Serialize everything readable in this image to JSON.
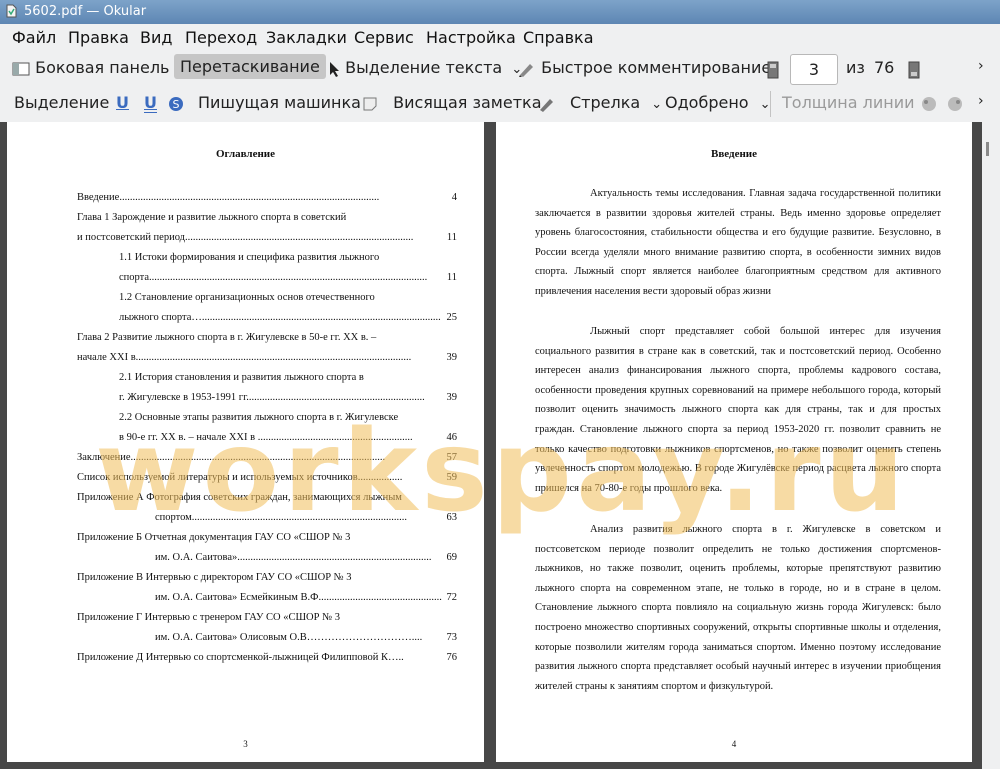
{
  "window": {
    "title": "5602.pdf  — Okular"
  },
  "menu": [
    "Файл",
    "Правка",
    "Вид",
    "Переход",
    "Закладки",
    "Сервис",
    "Настройка",
    "Справка"
  ],
  "toolbar1": {
    "sidebar": "Боковая панель",
    "drag": "Перетаскивание",
    "text_select": "Выделение текста",
    "quick_annot": "Быстрое комментирование",
    "page_current": "3",
    "page_of": "из",
    "page_total": "76"
  },
  "toolbar2": {
    "select": "Выделение",
    "typewriter": "Пишущая машинка",
    "note": "Висящая заметка",
    "arrow": "Стрелка",
    "stamp": "Одобрено",
    "line_width": "Толщина линии"
  },
  "page_left": {
    "title": "Оглавление",
    "toc": [
      {
        "text": "Введение...................................................................................................",
        "page": "4"
      },
      {
        "text": "Глава 1 Зарождение и развитие лыжного спорта в советский",
        "page": ""
      },
      {
        "text": "и постсоветский период.......................................................................................",
        "page": "11"
      },
      {
        "text": "1.1 Истоки формирования и специфика развития лыжного",
        "page": ""
      },
      {
        "text": "спорта..........................................................................................................",
        "page": "11"
      },
      {
        "text": "1.2 Становление организационных основ отечественного",
        "page": ""
      },
      {
        "text": "лыжного спорта…...........................................................................................",
        "page": "25"
      },
      {
        "text": "Глава 2 Развитие лыжного спорта в г. Жигулевске в 50-е гг. ХХ в. –",
        "page": ""
      },
      {
        "text": "начале XXI в.........................................................................................................",
        "page": "39"
      },
      {
        "text": "2.1 История становления и развития лыжного спорта в",
        "page": ""
      },
      {
        "text": "г. Жигулевске в 1953-1991 гг....................................................................",
        "page": "39"
      },
      {
        "text": "2.2 Основные этапы развития лыжного спорта в г. Жигулевске",
        "page": ""
      },
      {
        "text": "в 90-е гг. ХХ в. – начале XXI в ...........................................................",
        "page": "46"
      },
      {
        "text": "Заключение.................................................................................................",
        "page": "57"
      },
      {
        "text": "Список используемой литературы и используемых источников.................",
        "page": "59"
      },
      {
        "text": "Приложение А  Фотография советских граждан, занимающихся лыжным",
        "page": ""
      },
      {
        "text": "спортом..................................................................................",
        "page": "63"
      },
      {
        "text": "Приложение Б  Отчетная документация ГАУ СО «СШОР № 3",
        "page": ""
      },
      {
        "text": "им. О.А. Саитова»..........................................................................",
        "page": "69"
      },
      {
        "text": "Приложение В  Интервью с директором ГАУ СО «СШОР № 3",
        "page": ""
      },
      {
        "text": "им. О.А. Саитова» Есмейкиным В.Ф.................................................",
        "page": "72"
      },
      {
        "text": "Приложение Г  Интервью с тренером ГАУ СО «СШОР № 3",
        "page": ""
      },
      {
        "text": "им. О.А. Саитова» Олисовым О.В…………………………....",
        "page": "73"
      },
      {
        "text": "Приложение Д  Интервью со спортсменкой-лыжницей Филипповой К…..",
        "page": "76"
      }
    ],
    "page_number": "3"
  },
  "page_right": {
    "title": "Введение",
    "paragraphs": [
      "Актуальность темы исследования. Главная задача государственной политики заключается в развитии здоровья жителей страны. Ведь именно здоровье определяет уровень благосостояния, стабильности общества и его будущие развитие. Безусловно, в России всегда уделяли много внимание развитию спорта, в особенности зимних видов спорта. Лыжный спорт является наиболее благоприятным средством для активного привлечения населения вести здоровый образ жизни",
      "Лыжный спорт представляет собой большой интерес для изучения социального развития в стране как в советский, так и постсоветский период. Особенно интересен анализ финансирования лыжного спорта, проблемы кадрового состава, особенности проведения крупных соревнований на примере небольшого города, который позволит оценить значимость лыжного спорта как для страны, так и для простых граждан. Становление лыжного спорта за период 1953-2020 гг. позволит сравнить не только качество подготовки лыжников спортсменов, но также позволит оценить степень увлеченность спортом молодежью. В городе Жигулёвске период расцвета лыжного спорта пришелся на 70-80-е годы прошлого века.",
      "Анализ развития лыжного спорта в г. Жигулевске в советском и постсоветском периоде позволит определить не только достижения спортсменов-лыжников, но также позволит, оценить проблемы, которые препятствуют развитию лыжного спорта на современном этапе, не только в городе, но и в стране в целом. Становление лыжного спорта повлияло на социальную жизнь города Жигулевск: было построено множество спортивных сооружений, открыты спортивные школы и отделения, которые позволили жителям города заниматься спортом. Именно поэтому исследование развития лыжного спорта представляет особый научный интерес в изучении приобщения жителей страны к занятиям спортом и физкультурой."
    ],
    "page_number": "4"
  },
  "watermark": "workspay.ru"
}
